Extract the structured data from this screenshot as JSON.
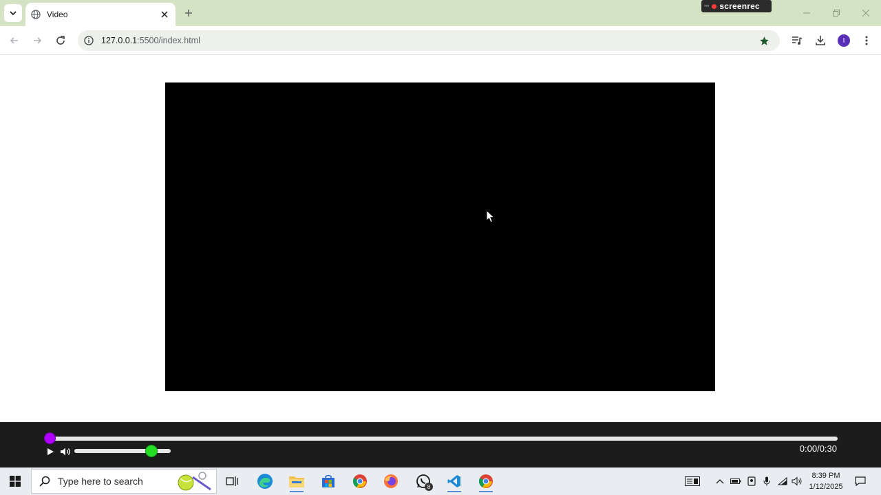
{
  "browser": {
    "tab_title": "Video",
    "url_host": "127.0.0.1",
    "url_path": ":5500/index.html",
    "recorder_label": "screenrec",
    "profile_initial": "I"
  },
  "player": {
    "progress": 0,
    "volume": 0.8,
    "time_display": "0:00/0:30",
    "colors": {
      "progress_thumb": "#b000ff",
      "volume_thumb": "#22dd22",
      "track": "#e6e6e6",
      "bar_bg": "#1c1c1c"
    }
  },
  "taskbar": {
    "search_placeholder": "Type here to search",
    "whatsapp_badge": "8",
    "clock_time": "8:39 PM",
    "clock_date": "1/12/2025",
    "apps": [
      "task-view-icon",
      "edge-icon",
      "file-explorer-icon",
      "store-icon",
      "chrome-icon",
      "firefox-icon",
      "whatsapp-icon",
      "vscode-icon",
      "chrome-icon"
    ]
  }
}
